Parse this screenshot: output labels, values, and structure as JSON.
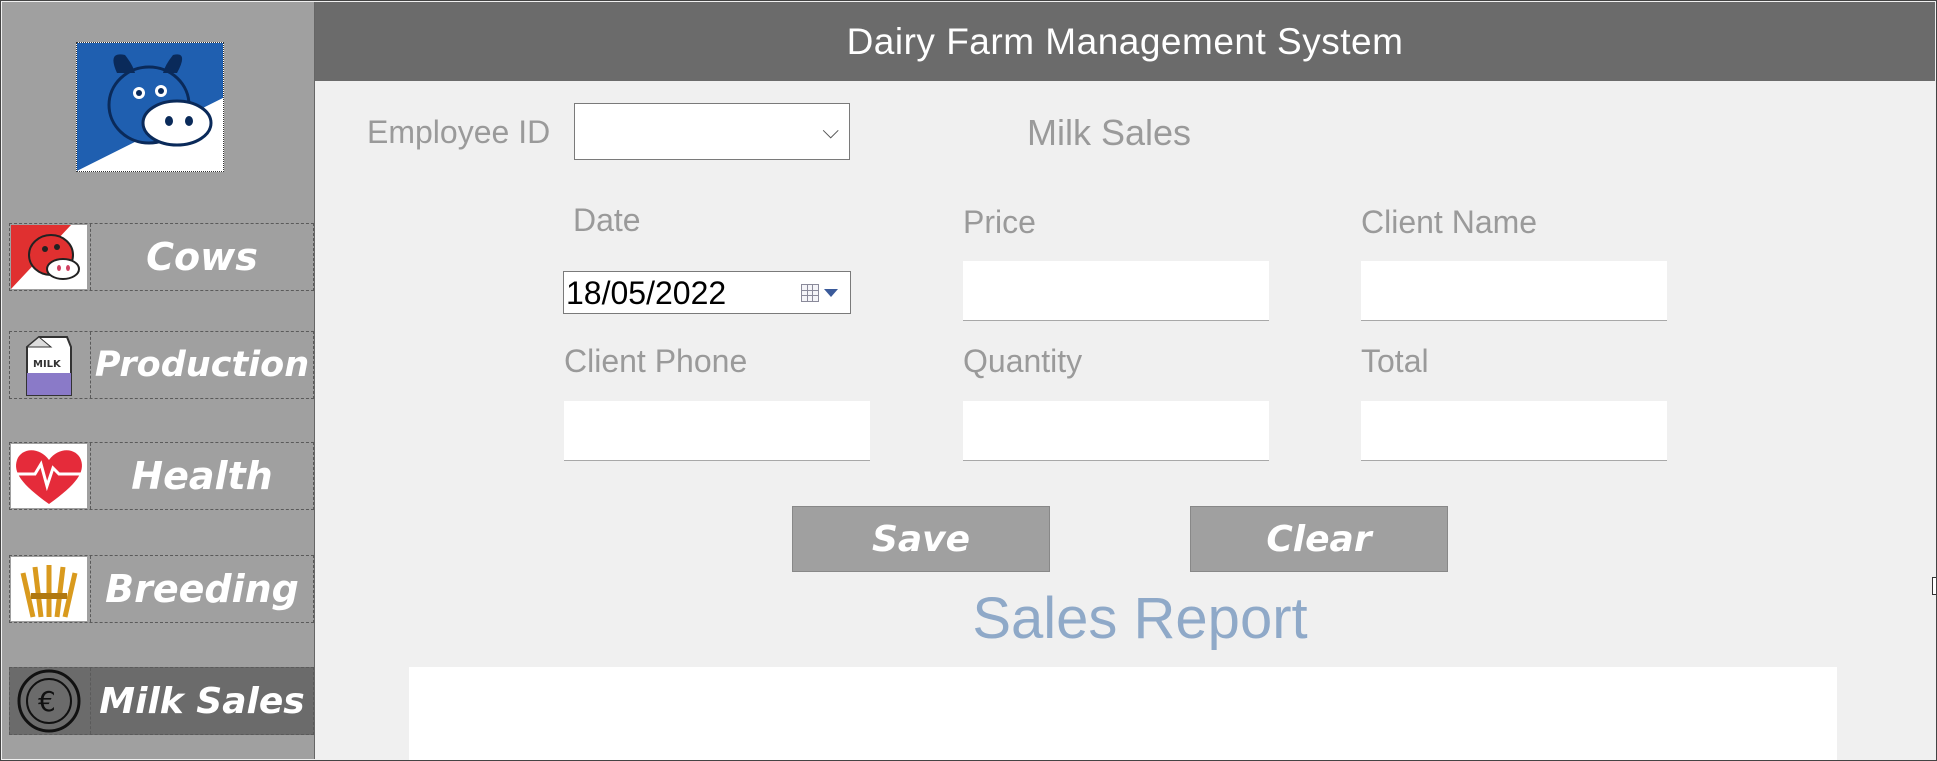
{
  "app": {
    "title": "Dairy Farm Management System"
  },
  "sidebar": {
    "logo_icon": "cow-logo-icon",
    "items": [
      {
        "label": "Cows",
        "icon": "cow-icon",
        "active": false
      },
      {
        "label": "Production",
        "icon": "milk-carton-icon",
        "active": false
      },
      {
        "label": "Health",
        "icon": "heart-pulse-icon",
        "active": false
      },
      {
        "label": "Breeding",
        "icon": "wheat-icon",
        "active": false
      },
      {
        "label": "Milk Sales",
        "icon": "euro-coin-icon",
        "active": true
      }
    ]
  },
  "form": {
    "section_title": "Milk Sales",
    "employee_id": {
      "label": "Employee ID",
      "value": ""
    },
    "date": {
      "label": "Date",
      "value": "18/05/2022"
    },
    "price": {
      "label": "Price",
      "value": ""
    },
    "client_name": {
      "label": "Client Name",
      "value": ""
    },
    "client_phone": {
      "label": "Client Phone",
      "value": ""
    },
    "quantity": {
      "label": "Quantity",
      "value": ""
    },
    "total": {
      "label": "Total",
      "value": ""
    }
  },
  "buttons": {
    "save": "Save",
    "clear": "Clear"
  },
  "report": {
    "title": "Sales Report"
  },
  "colors": {
    "header_bg": "#6b6b6b",
    "sidebar_bg": "#a0a0a0",
    "active_nav": "#6b6b6b",
    "report_title": "#8fa9c8",
    "label_gray": "#9a9a9a"
  }
}
